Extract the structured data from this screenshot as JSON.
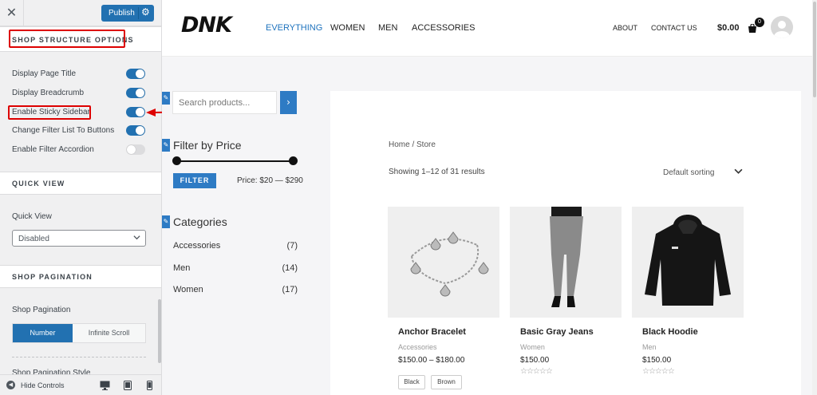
{
  "customizer": {
    "close_glyph": "✕",
    "publish_label": "Publish",
    "publish_gear": "⚙",
    "section_structure": "SHOP STRUCTURE OPTIONS",
    "options": [
      {
        "label": "Display Page Title",
        "enabled": true
      },
      {
        "label": "Display Breadcrumb",
        "enabled": true
      },
      {
        "label": "Enable Sticky Sidebar",
        "enabled": true
      },
      {
        "label": "Change Filter List To Buttons",
        "enabled": true
      },
      {
        "label": "Enable Filter Accordion",
        "enabled": false
      }
    ],
    "section_quick_view": "QUICK VIEW",
    "quick_view_label": "Quick View",
    "quick_view_value": "Disabled",
    "section_pagination": "SHOP PAGINATION",
    "pagination_label": "Shop Pagination",
    "pagination_options": [
      "Number",
      "Infinite Scroll"
    ],
    "pagination_selected": "Number",
    "cut_label": "Shop Pagination Style",
    "footer": {
      "hide_label": "Hide Controls",
      "devices": [
        "desktop-icon",
        "tablet-icon",
        "mobile-icon"
      ]
    },
    "accent_color": "#2271b1",
    "highlight_color": "#dd0000"
  },
  "site": {
    "logo": "DNK",
    "nav": [
      "EVERYTHING",
      "WOMEN",
      "MEN",
      "ACCESSORIES"
    ],
    "nav_right": [
      "ABOUT",
      "CONTACT US"
    ],
    "cart_total": "$0.00",
    "cart_count": "0",
    "brand_color": "#1e73be"
  },
  "sidebar": {
    "search_placeholder": "Search products...",
    "search_button_glyph": "›",
    "filter_title": "Filter by Price",
    "filter_button": "FILTER",
    "price_text": "Price: $20 — $290",
    "categories_title": "Categories",
    "categories": [
      {
        "name": "Accessories",
        "count": "(7)"
      },
      {
        "name": "Men",
        "count": "(14)"
      },
      {
        "name": "Women",
        "count": "(17)"
      }
    ]
  },
  "shop": {
    "breadcrumb": "Home / Store",
    "result_count": "Showing 1–12 of 31 results",
    "ordering": "Default sorting",
    "products": [
      {
        "name": "Anchor Bracelet",
        "category": "Accessories",
        "price": "$150.00 – $180.00",
        "rating": "",
        "swatches": [
          "Black",
          "Brown"
        ]
      },
      {
        "name": "Basic Gray Jeans",
        "category": "Women",
        "price": "$150.00",
        "rating": "☆☆☆☆☆",
        "swatches": []
      },
      {
        "name": "Black Hoodie",
        "category": "Men",
        "price": "$150.00",
        "rating": "☆☆☆☆☆",
        "swatches": []
      }
    ]
  }
}
